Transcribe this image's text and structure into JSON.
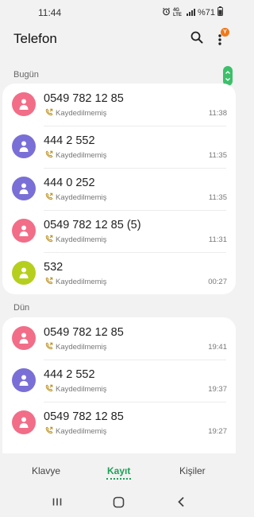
{
  "status_bar": {
    "time": "11:44",
    "network": "4G LTE",
    "battery": "%71"
  },
  "header": {
    "title": "Telefon",
    "badge": "Y"
  },
  "colors": {
    "pink": "#f26d88",
    "purple": "#7a6fd6",
    "lime": "#b6cf1e",
    "green": "#1ea058",
    "call_icon": "#b8860b"
  },
  "sections": [
    {
      "label": "Bugün",
      "calls": [
        {
          "number": "0549 782 12 85",
          "status": "Kaydedilmemiş",
          "time": "11:38",
          "avatar_color": "pink"
        },
        {
          "number": "444 2 552",
          "status": "Kaydedilmemiş",
          "time": "11:35",
          "avatar_color": "purple"
        },
        {
          "number": "444 0 252",
          "status": "Kaydedilmemiş",
          "time": "11:35",
          "avatar_color": "purple"
        },
        {
          "number": "0549 782 12 85 (5)",
          "status": "Kaydedilmemiş",
          "time": "11:31",
          "avatar_color": "pink"
        },
        {
          "number": "532",
          "status": "Kaydedilmemiş",
          "time": "00:27",
          "avatar_color": "lime"
        }
      ]
    },
    {
      "label": "Dün",
      "calls": [
        {
          "number": "0549 782 12 85",
          "status": "Kaydedilmemiş",
          "time": "19:41",
          "avatar_color": "pink"
        },
        {
          "number": "444 2 552",
          "status": "Kaydedilmemiş",
          "time": "19:37",
          "avatar_color": "purple"
        },
        {
          "number": "0549 782 12 85",
          "status": "Kaydedilmemiş",
          "time": "19:27",
          "avatar_color": "pink"
        }
      ]
    }
  ],
  "tabs": [
    {
      "label": "Klavye",
      "active": false
    },
    {
      "label": "Kayıt",
      "active": true
    },
    {
      "label": "Kişiler",
      "active": false
    }
  ],
  "icons": {
    "search": "search-icon",
    "more": "more-options-icon",
    "call_type": "outgoing-call-icon",
    "contact": "person-icon"
  }
}
